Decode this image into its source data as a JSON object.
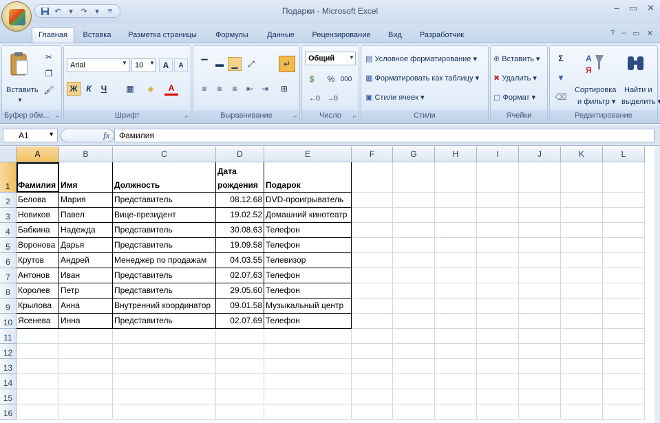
{
  "window": {
    "title": "Подарки - Microsoft Excel",
    "buttons": [
      "–",
      "▭",
      "✕"
    ]
  },
  "qat": {
    "save": "save-icon",
    "undo": "undo-icon",
    "redo": "redo-icon"
  },
  "tabs": [
    "Главная",
    "Вставка",
    "Разметка страницы",
    "Формулы",
    "Данные",
    "Рецензирование",
    "Вид",
    "Разработчик"
  ],
  "active_tab": "Главная",
  "tab_right": [
    "?",
    "–",
    "▭",
    "✕"
  ],
  "ribbon": {
    "clipboard": {
      "paste_label": "Вставить",
      "label": "Буфер обм..."
    },
    "font": {
      "name": "Arial",
      "size": "10",
      "bold": "Ж",
      "italic": "К",
      "underline": "Ч",
      "grow": "A",
      "shrink": "A",
      "label": "Шрифт"
    },
    "alignment": {
      "label": "Выравнивание"
    },
    "number": {
      "format": "Общий",
      "percent": "%",
      "thousands": "000",
      "label": "Число"
    },
    "styles": {
      "conditional": "Условное форматирование",
      "as_table": "Форматировать как таблицу",
      "cell_styles": "Стили ячеек",
      "label": "Стили"
    },
    "cells": {
      "insert": "Вставить",
      "delete": "Удалить",
      "format": "Формат",
      "label": "Ячейки"
    },
    "editing": {
      "sigma": "Σ",
      "sort_line1": "Сортировка",
      "sort_line2": "и фильтр",
      "find_line1": "Найти и",
      "find_line2": "выделить",
      "label": "Редактирование"
    }
  },
  "formula_bar": {
    "cell_ref": "A1",
    "fx": "fx",
    "value": "Фамилия"
  },
  "sheet": {
    "columns": [
      "A",
      "B",
      "C",
      "D",
      "E",
      "F",
      "G",
      "H",
      "I",
      "J",
      "K",
      "L"
    ],
    "rows": [
      "1",
      "2",
      "3",
      "4",
      "5",
      "6",
      "7",
      "8",
      "9",
      "10",
      "11",
      "12",
      "13",
      "14",
      "15",
      "16"
    ],
    "header": [
      "Фамилия",
      "Имя",
      "Должность",
      "Дата рождения",
      "Подарок"
    ],
    "data": [
      [
        "Белова",
        "Мария",
        "Представитель",
        "08.12.68",
        "DVD-проигрыватель"
      ],
      [
        "Новиков",
        "Павел",
        "Вице-президент",
        "19.02.52",
        "Домашний кинотеатр"
      ],
      [
        "Бабкина",
        "Надежда",
        "Представитель",
        "30.08.63",
        "Телефон"
      ],
      [
        "Воронова",
        "Дарья",
        "Представитель",
        "19.09.58",
        "Телефон"
      ],
      [
        "Крутов",
        "Андрей",
        "Менеджер по продажам",
        "04.03.55",
        "Телевизор"
      ],
      [
        "Антонов",
        "Иван",
        "Представитель",
        "02.07.63",
        "Телефон"
      ],
      [
        "Королев",
        "Петр",
        "Представитель",
        "29.05.60",
        "Телефон"
      ],
      [
        "Крылова",
        "Анна",
        "Внутренний координатор",
        "09.01.58",
        "Музыкальный центр"
      ],
      [
        "Ясенева",
        "Инна",
        "Представитель",
        "02.07.69",
        "Телефон"
      ]
    ],
    "selected_cell": "A1"
  }
}
